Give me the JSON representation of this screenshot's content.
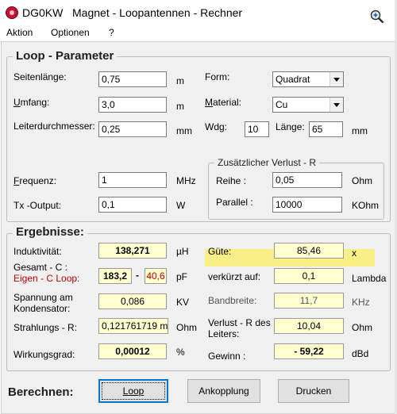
{
  "window": {
    "title_prefix": "DG0KW",
    "title": "Magnet - Loopantennen - Rechner"
  },
  "menu": {
    "items": [
      "Aktion",
      "Optionen",
      "?"
    ]
  },
  "loop": {
    "group_title": "Loop - Parameter",
    "seitenlaenge": {
      "label": "Seitenlänge:",
      "value": "0,75",
      "unit": "m"
    },
    "umfang": {
      "label_u": "U",
      "label_rest": "mfang:",
      "value": "3,0",
      "unit": "m"
    },
    "leiter": {
      "label": "Leiterdurchmesser:",
      "value": "0,25",
      "unit": "mm"
    },
    "form": {
      "label": "Form:",
      "value": "Quadrat"
    },
    "material": {
      "label_u": "M",
      "label_rest": "aterial:",
      "value": "Cu"
    },
    "wdg": {
      "label": "Wdg:",
      "value": "10"
    },
    "laenge": {
      "label": "Länge:",
      "value": "65",
      "unit": "mm"
    },
    "frequenz": {
      "label_u": "F",
      "label_rest": "requenz:",
      "value": "1",
      "unit": "MHz"
    },
    "tx": {
      "label": "Tx -Output:",
      "value": "0,1",
      "unit": "W"
    }
  },
  "verlust": {
    "group_title": "Zusätzlicher Verlust - R",
    "reihe": {
      "label": "Reihe :",
      "value": "0,05",
      "unit": "Ohm"
    },
    "parallel": {
      "label": "Parallel :",
      "value": "10000",
      "unit": "KOhm"
    }
  },
  "ergebnisse": {
    "group_title": "Ergebnisse:",
    "induktivitaet": {
      "label": "Induktivität:",
      "value": "138,271",
      "unit": "µH"
    },
    "gesamt_label": "Gesamt - C     :",
    "eigen_label": "Eigen - C  Loop:",
    "c_gesamt": "183,2",
    "c_sep": "-",
    "c_eigen": "40,6",
    "c_unit": "pF",
    "spannung": {
      "label1": "Spannung am",
      "label2": "Kondensator:",
      "value": "0,086",
      "unit": "KV"
    },
    "strahlung": {
      "label": "Strahlungs - R:",
      "value": "0,121761719 m",
      "unit": "Ohm"
    },
    "wirkungsgrad": {
      "label": "Wirkungsgrad:",
      "value": "0,00012",
      "unit": "%"
    },
    "guete": {
      "label": "Güte:",
      "value": "85,46",
      "unit": "x"
    },
    "verkuerzt": {
      "label": "verkürzt auf:",
      "value": "0,1",
      "unit": "Lambda"
    },
    "bandbreite": {
      "label": "Bandbreite:",
      "value": "11,7",
      "unit": "KHz"
    },
    "verlust_r": {
      "label1": "Verlust - R des",
      "label2": "Leiters:",
      "value": "10,04",
      "unit": "Ohm"
    },
    "gewinn": {
      "label": "Gewinn :",
      "value": "- 59,22",
      "unit": "dBd"
    }
  },
  "actions": {
    "label": "Berechnen:",
    "loop": "Loop",
    "ankopplung": "Ankopplung",
    "drucken": "Drucken"
  },
  "colors": {
    "highlight": "#fcee74",
    "output_bg": "#ffffd0",
    "warning_red": "#c00000"
  }
}
